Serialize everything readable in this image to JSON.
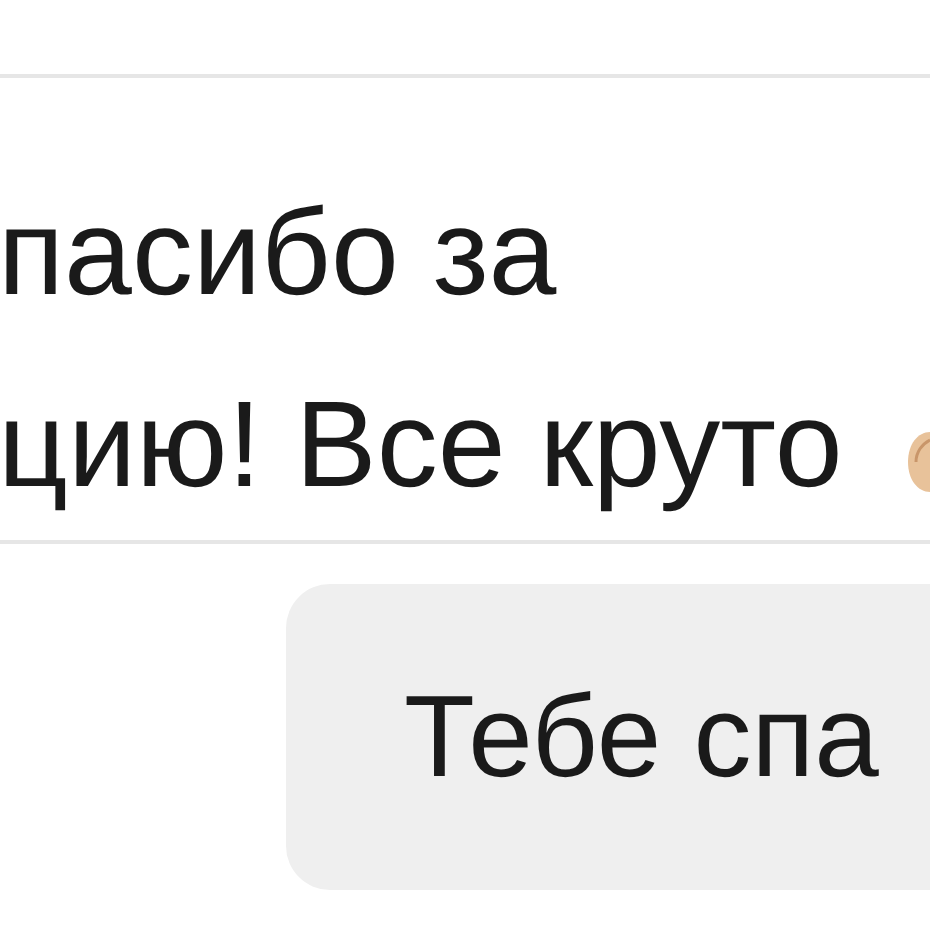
{
  "messages": [
    {
      "kind": "incoming",
      "lines": [
        "пасибо за",
        "цию! Все круто"
      ]
    },
    {
      "kind": "outgoing",
      "lines": [
        "Тебе спа"
      ]
    }
  ]
}
